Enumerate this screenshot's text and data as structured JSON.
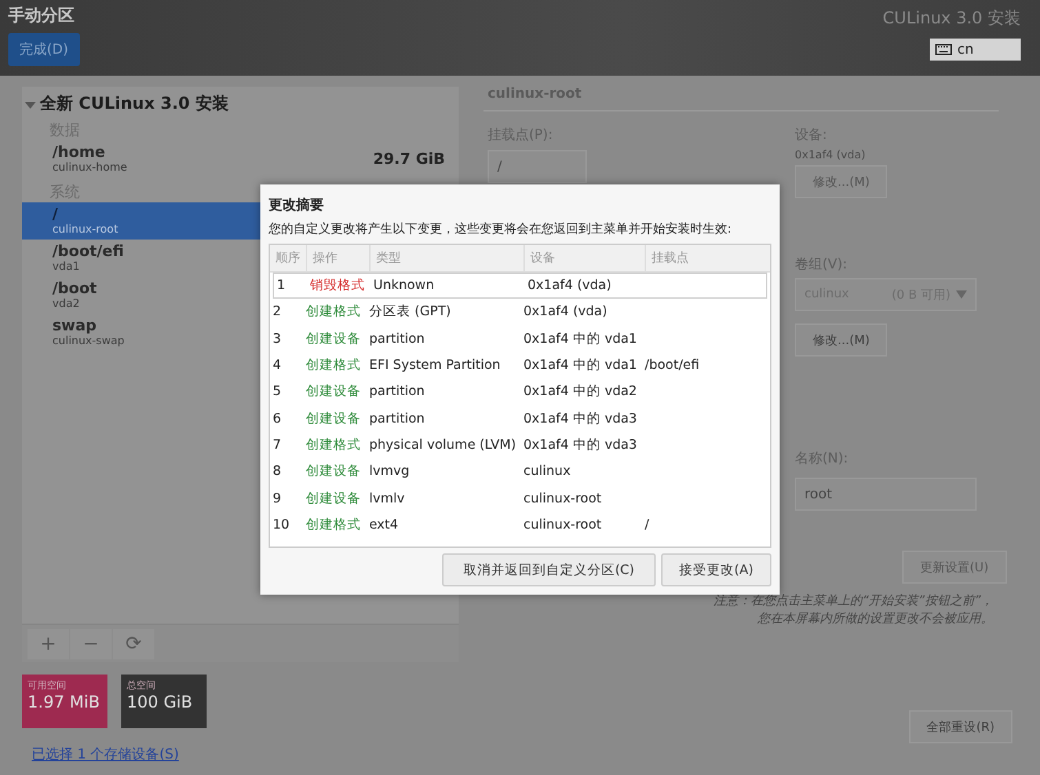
{
  "header": {
    "title": "手动分区",
    "done_button": "完成(D)",
    "product": "CULinux 3.0 安装",
    "keyboard": "cn"
  },
  "tree": {
    "title": "全新 CULinux 3.0 安装",
    "expanded": true,
    "sections": [
      {
        "label": "数据",
        "items": [
          {
            "name": "/home",
            "device": "culinux-home",
            "size": "29.7 GiB",
            "selected": false
          }
        ]
      },
      {
        "label": "系统",
        "items": [
          {
            "name": "/",
            "device": "culinux-root",
            "selected": true
          },
          {
            "name": "/boot/efi",
            "device": "vda1",
            "selected": false
          },
          {
            "name": "/boot",
            "device": "vda2",
            "selected": false
          },
          {
            "name": "swap",
            "device": "culinux-swap",
            "selected": false
          }
        ]
      }
    ]
  },
  "toolbar": [
    "+",
    "−",
    "⟳"
  ],
  "space": [
    {
      "label": "可用空间",
      "value": "1.97 MiB",
      "kind": "available"
    },
    {
      "label": "总空间",
      "value": "100 GiB",
      "kind": "total"
    }
  ],
  "storage_link": "已选择 1 个存储设备(S)",
  "details": {
    "title": "culinux-root",
    "mount_label": "挂载点(P):",
    "mount_value": "/",
    "device_label": "设备:",
    "device_value": "0x1af4 (vda)",
    "device_button": "修改...(M)",
    "vg_label": "卷组(V):",
    "vg_value": "culinux",
    "vg_free": "(0 B 可用)",
    "vg_button": "修改...(M)",
    "name_label": "名称(N):",
    "name_value": "root",
    "update_button": "更新设置(U)",
    "note": [
      "注意：在您点击主菜单上的“开始安装”按钮之前”，",
      "您在本屏幕内所做的设置更改不会被应用。"
    ],
    "reset_button": "全部重设(R)"
  },
  "dialog": {
    "title": "更改摘要",
    "message": "您的自定义更改将产生以下变更，这些变更将会在您返回到主菜单并开始安装时生效:",
    "columns": [
      "顺序",
      "操作",
      "类型",
      "设备",
      "挂载点"
    ],
    "rows": [
      {
        "order": "1",
        "action": "销毁格式",
        "kind": "destroy",
        "type": "Unknown",
        "device": "0x1af4 (vda)",
        "mount": "",
        "selected": true
      },
      {
        "order": "2",
        "action": "创建格式",
        "kind": "create",
        "type": "分区表 (GPT)",
        "device": "0x1af4 (vda)",
        "mount": "",
        "selected": false
      },
      {
        "order": "3",
        "action": "创建设备",
        "kind": "create",
        "type": "partition",
        "device": "0x1af4 中的 vda1",
        "mount": "",
        "selected": false
      },
      {
        "order": "4",
        "action": "创建格式",
        "kind": "create",
        "type": "EFI System Partition",
        "device": "0x1af4 中的 vda1",
        "mount": "/boot/efi",
        "selected": false
      },
      {
        "order": "5",
        "action": "创建设备",
        "kind": "create",
        "type": "partition",
        "device": "0x1af4 中的 vda2",
        "mount": "",
        "selected": false
      },
      {
        "order": "6",
        "action": "创建设备",
        "kind": "create",
        "type": "partition",
        "device": "0x1af4 中的 vda3",
        "mount": "",
        "selected": false
      },
      {
        "order": "7",
        "action": "创建格式",
        "kind": "create",
        "type": "physical volume (LVM)",
        "device": "0x1af4 中的 vda3",
        "mount": "",
        "selected": false
      },
      {
        "order": "8",
        "action": "创建设备",
        "kind": "create",
        "type": "lvmvg",
        "device": "culinux",
        "mount": "",
        "selected": false
      },
      {
        "order": "9",
        "action": "创建设备",
        "kind": "create",
        "type": "lvmlv",
        "device": "culinux-root",
        "mount": "",
        "selected": false
      },
      {
        "order": "10",
        "action": "创建格式",
        "kind": "create",
        "type": "ext4",
        "device": "culinux-root",
        "mount": "/",
        "selected": false
      }
    ],
    "buttons": [
      "取消并返回到自定义分区(C)",
      "接受更改(A)"
    ]
  }
}
